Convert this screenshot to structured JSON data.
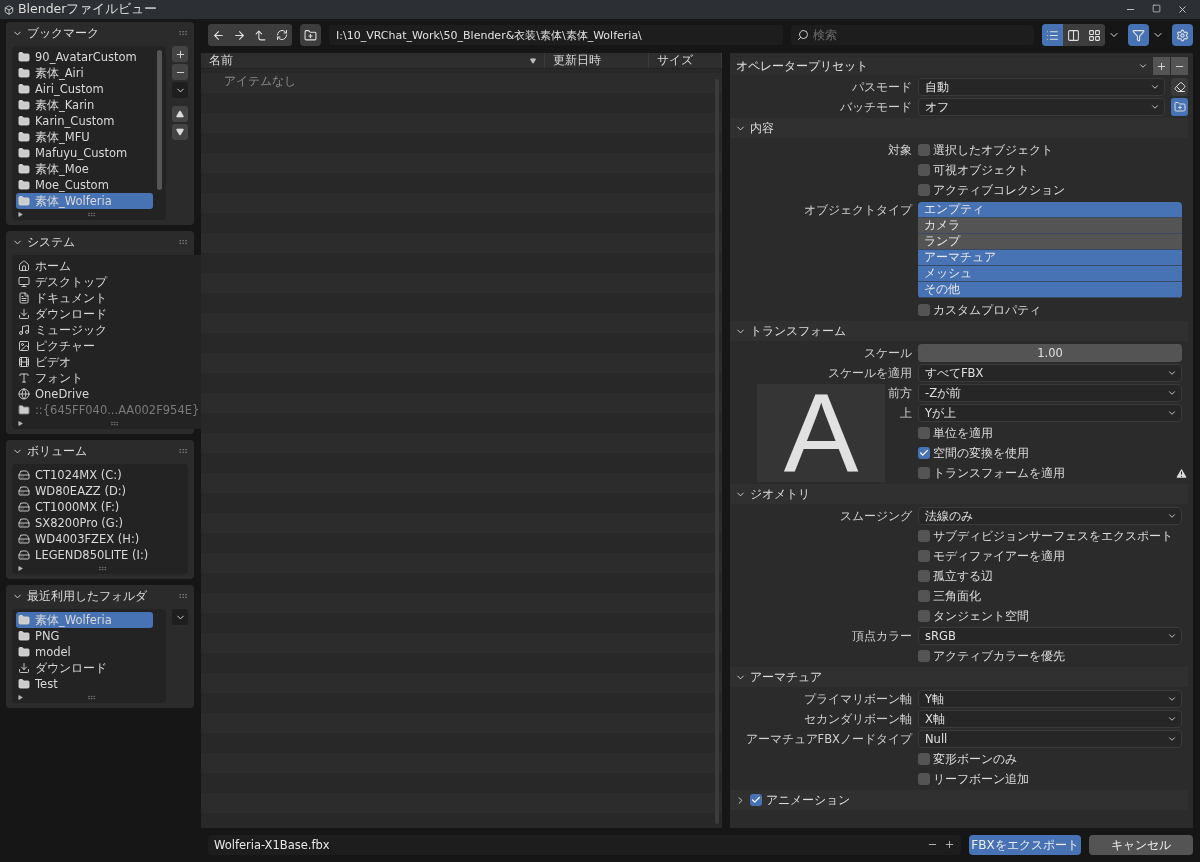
{
  "window": {
    "title": "Blenderファイルビュー"
  },
  "sidebar": {
    "panels": [
      {
        "kind": "bookmarks",
        "title": "ブックマーク",
        "expanded": true,
        "items": [
          {
            "kind": "folder",
            "label": "90_AvatarCustom",
            "selected": false
          },
          {
            "kind": "folder",
            "label": "素体_Airi",
            "selected": false
          },
          {
            "kind": "folder",
            "label": "Airi_Custom",
            "selected": false
          },
          {
            "kind": "folder",
            "label": "素体_Karin",
            "selected": false
          },
          {
            "kind": "folder",
            "label": "Karin_Custom",
            "selected": false
          },
          {
            "kind": "folder",
            "label": "素体_MFU",
            "selected": false
          },
          {
            "kind": "folder",
            "label": "Mafuyu_Custom",
            "selected": false
          },
          {
            "kind": "folder",
            "label": "素体_Moe",
            "selected": false
          },
          {
            "kind": "folder",
            "label": "Moe_Custom",
            "selected": false
          },
          {
            "kind": "folder",
            "label": "素体_Wolferia",
            "selected": true
          }
        ]
      },
      {
        "kind": "system",
        "title": "システム",
        "expanded": true,
        "items": [
          {
            "kind": "home",
            "label": "ホーム",
            "selected": false,
            "disabled": false
          },
          {
            "kind": "desktop",
            "label": "デスクトップ",
            "selected": false,
            "disabled": false
          },
          {
            "kind": "documents",
            "label": "ドキュメント",
            "selected": false,
            "disabled": false
          },
          {
            "kind": "download",
            "label": "ダウンロード",
            "selected": false,
            "disabled": false
          },
          {
            "kind": "music",
            "label": "ミュージック",
            "selected": false,
            "disabled": false
          },
          {
            "kind": "picture",
            "label": "ピクチャー",
            "selected": false,
            "disabled": false
          },
          {
            "kind": "video",
            "label": "ビデオ",
            "selected": false,
            "disabled": false
          },
          {
            "kind": "font",
            "label": "フォント",
            "selected": false,
            "disabled": false
          },
          {
            "kind": "globe",
            "label": "OneDrive",
            "selected": false,
            "disabled": false
          },
          {
            "kind": "folder",
            "label": "::{645FF040...AA002F954E}",
            "selected": false,
            "disabled": true
          }
        ]
      },
      {
        "kind": "volumes",
        "title": "ボリューム",
        "expanded": true,
        "items": [
          {
            "kind": "drive",
            "label": "CT1024MX (C:)",
            "selected": false
          },
          {
            "kind": "drive",
            "label": "WD80EAZZ (D:)",
            "selected": false
          },
          {
            "kind": "drive",
            "label": "CT1000MX (F:)",
            "selected": false
          },
          {
            "kind": "drive",
            "label": "SX8200Pro (G:)",
            "selected": false
          },
          {
            "kind": "drive",
            "label": "WD4003FZEX (H:)",
            "selected": false
          },
          {
            "kind": "drive",
            "label": "LEGEND850LITE (I:)",
            "selected": false
          }
        ]
      },
      {
        "kind": "recent",
        "title": "最近利用したフォルダ",
        "expanded": true,
        "items": [
          {
            "kind": "folder",
            "label": "素体_Wolferia",
            "selected": true
          },
          {
            "kind": "folder",
            "label": "PNG",
            "selected": false
          },
          {
            "kind": "folder",
            "label": "model",
            "selected": false
          },
          {
            "kind": "download",
            "label": "ダウンロード",
            "selected": false
          },
          {
            "kind": "folder",
            "label": "Test",
            "selected": false
          }
        ]
      }
    ]
  },
  "toolbar": {
    "path": "I:\\10_VRChat_Work\\50_Blender&衣装\\素体\\素体_Wolferia\\",
    "search": {
      "placeholder": "検索"
    },
    "display_modes": [
      {
        "kind": "vertical",
        "selected": true
      },
      {
        "kind": "horizontal",
        "selected": false
      },
      {
        "kind": "thumbnails",
        "selected": false
      }
    ],
    "filter": {
      "on": true
    }
  },
  "file_list": {
    "columns": [
      {
        "label": "名前",
        "sorted": true
      },
      {
        "label": "更新日時",
        "sorted": false
      },
      {
        "label": "サイズ",
        "sorted": false
      }
    ],
    "empty_text": "アイテムなし"
  },
  "properties": {
    "preset": "オペレータープリセット",
    "top_rows": [
      {
        "kind": "dropdown",
        "label": "パスモード",
        "value": "自動",
        "toggle": {
          "kind": "eraser",
          "on": false
        }
      },
      {
        "kind": "dropdown",
        "label": "バッチモード",
        "value": "オフ",
        "toggle": {
          "kind": "folder",
          "on": true
        }
      }
    ],
    "sections": [
      {
        "kind": "plain",
        "title": "内容",
        "expanded": true,
        "rows": [
          {
            "kind": "checkbox",
            "label": "対象",
            "text": "選択したオブジェクト",
            "checked": false
          },
          {
            "kind": "checkbox",
            "text": "可視オブジェクト",
            "checked": false
          },
          {
            "kind": "checkbox",
            "text": "アクティブコレクション",
            "checked": false
          },
          {
            "kind": "multiselect",
            "label": "オブジェクトタイプ",
            "options": [
              {
                "label": "エンプティ",
                "selected": true
              },
              {
                "label": "カメラ",
                "selected": false
              },
              {
                "label": "ランプ",
                "selected": false
              },
              {
                "label": "アーマチュア",
                "selected": true
              },
              {
                "label": "メッシュ",
                "selected": true
              },
              {
                "label": "その他",
                "selected": true
              }
            ]
          },
          {
            "kind": "checkbox",
            "text": "カスタムプロパティ",
            "checked": false
          }
        ]
      },
      {
        "kind": "plain",
        "title": "トランスフォーム",
        "expanded": true,
        "rows": [
          {
            "kind": "number",
            "label": "スケール",
            "value": "1.00"
          },
          {
            "kind": "dropdown",
            "label": "スケールを適用",
            "value": "すべてFBX"
          },
          {
            "kind": "dropdown",
            "label": "前方",
            "value": "-Zが前"
          },
          {
            "kind": "dropdown",
            "label": "上",
            "value": "Yが上"
          },
          {
            "kind": "checkbox",
            "text": "単位を適用",
            "checked": false
          },
          {
            "kind": "checkbox",
            "text": "空間の変換を使用",
            "checked": true
          },
          {
            "kind": "checkbox",
            "text": "トランスフォームを適用",
            "checked": false,
            "warning": true
          }
        ]
      },
      {
        "kind": "plain",
        "title": "ジオメトリ",
        "expanded": true,
        "rows": [
          {
            "kind": "dropdown",
            "label": "スムージング",
            "value": "法線のみ"
          },
          {
            "kind": "checkbox",
            "text": "サブディビジョンサーフェスをエクスポート",
            "checked": false
          },
          {
            "kind": "checkbox",
            "text": "モディファイアーを適用",
            "checked": false
          },
          {
            "kind": "checkbox",
            "text": "孤立する辺",
            "checked": false
          },
          {
            "kind": "checkbox",
            "text": "三角面化",
            "checked": false
          },
          {
            "kind": "checkbox",
            "text": "タンジェント空間",
            "checked": false
          },
          {
            "kind": "dropdown",
            "label": "頂点カラー",
            "value": "sRGB"
          },
          {
            "kind": "checkbox",
            "text": "アクティブカラーを優先",
            "checked": false
          }
        ]
      },
      {
        "kind": "plain",
        "title": "アーマチュア",
        "expanded": true,
        "rows": [
          {
            "kind": "dropdown",
            "label": "プライマリボーン軸",
            "value": "Y軸"
          },
          {
            "kind": "dropdown",
            "label": "セカンダリボーン軸",
            "value": "X軸"
          },
          {
            "kind": "dropdown",
            "label": "アーマチュアFBXノードタイプ",
            "value": "Null"
          },
          {
            "kind": "checkbox",
            "text": "変形ボーンのみ",
            "checked": false
          },
          {
            "kind": "checkbox",
            "text": "リーフボーン追加",
            "checked": false
          }
        ]
      },
      {
        "kind": "toggle",
        "title": "アニメーション",
        "expanded": false,
        "checked": true
      }
    ]
  },
  "ime_indicator": {
    "text": "A"
  },
  "bottom_bar": {
    "filename": "Wolferia-X1Base.fbx",
    "buttons": [
      {
        "kind": "primary",
        "label": "FBXをエクスポート"
      },
      {
        "kind": "secondary",
        "label": "キャンセル"
      }
    ]
  }
}
